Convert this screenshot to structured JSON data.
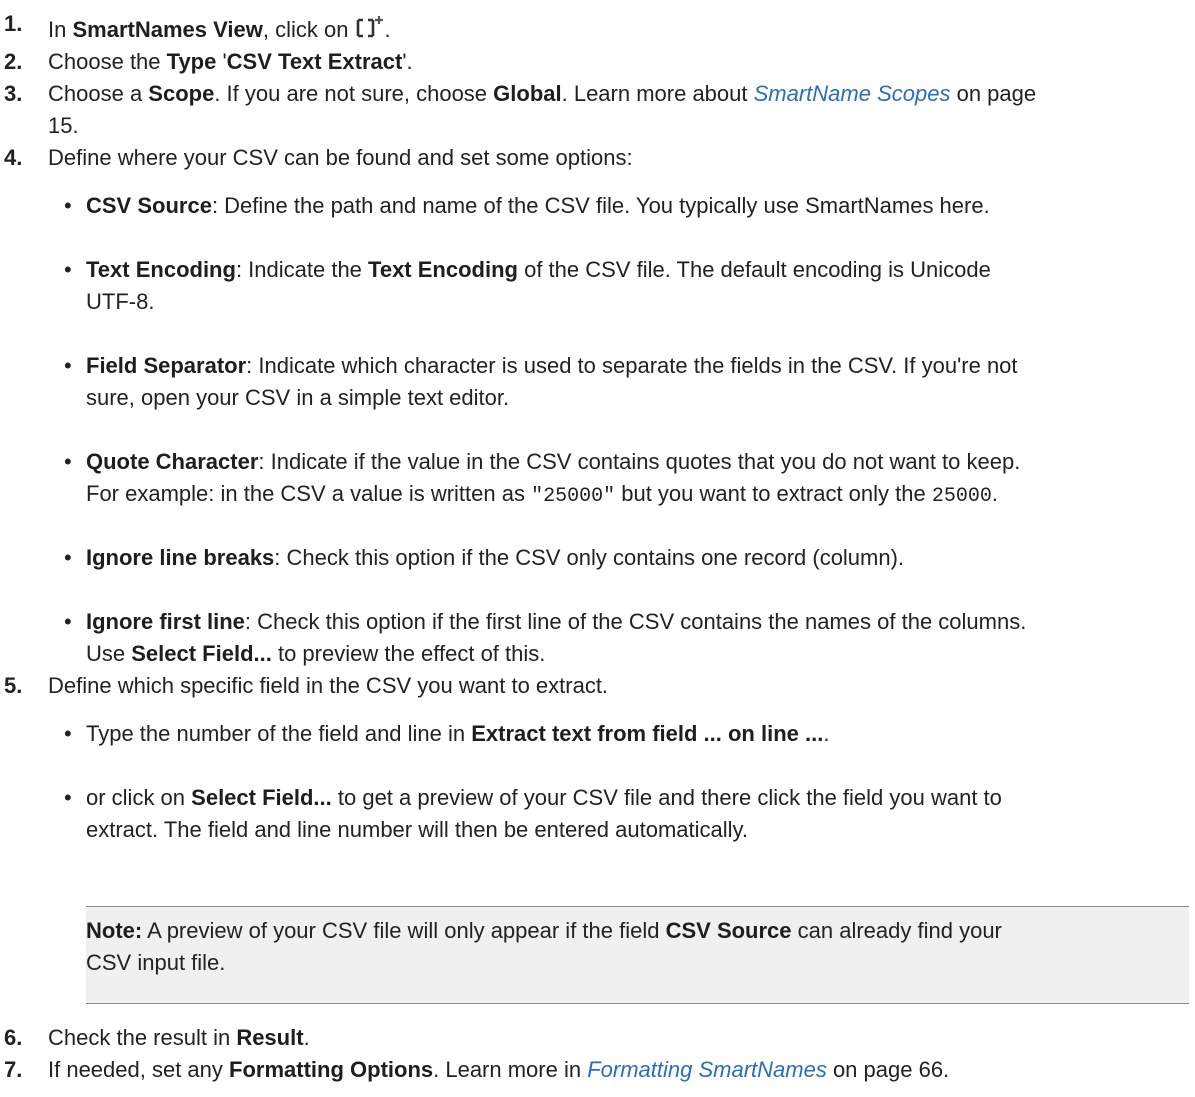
{
  "steps": [
    {
      "num": "1.",
      "a": "In ",
      "b1": "SmartNames View",
      "c": ", click on ",
      "d": "."
    },
    {
      "num": "2.",
      "a": "Choose the ",
      "b1": "Type",
      "c": " '",
      "b2": "CSV Text Extract",
      "d": "'."
    },
    {
      "num": "3.",
      "a": "Choose a ",
      "b1": "Scope",
      "c": ". If you are not sure, choose ",
      "b2": "Global",
      "d": ". Learn more about ",
      "link": "SmartName Scopes",
      "e": " on page",
      "line2": "15."
    },
    {
      "num": "4.",
      "a": "Define where your CSV can be found and set some options:"
    },
    {
      "num": "5.",
      "a": "Define which specific field in the CSV you want to extract."
    },
    {
      "num": "6.",
      "a": "Check the result in ",
      "b1": "Result",
      "c": "."
    },
    {
      "num": "7.",
      "a": "If needed, set any ",
      "b1": "Formatting Options",
      "c": ". Learn more in ",
      "link": "Formatting SmartNames",
      "d": "  on page 66."
    }
  ],
  "options": {
    "csv_source": {
      "label": "CSV Source",
      "text": ": Define the path and name of the CSV file. You typically use SmartNames here."
    },
    "text_encoding": {
      "label": "Text Encoding",
      "a": ": Indicate the ",
      "b": "Text Encoding",
      "c": " of the CSV file. The default encoding is Unicode",
      "line2": "UTF-8."
    },
    "field_separator": {
      "label": "Field Separator",
      "a": ": Indicate which character is used to separate the fields in the CSV. If you're not",
      "line2": "sure, open your CSV in a simple text editor."
    },
    "quote_character": {
      "label": "Quote Character",
      "a": ": Indicate if the value in the CSV contains quotes that you do not want to keep.",
      "line2a": "For example: in the CSV a value is written as ",
      "code1": "\"25000\"",
      "line2b": " but you want to extract only the ",
      "code2": "25000",
      "line2c": "."
    },
    "ignore_line_breaks": {
      "label": "Ignore line breaks",
      "text": ": Check this option if the CSV only contains one record (column)."
    },
    "ignore_first_line": {
      "label": "Ignore first line",
      "a": ": Check this option if the first line of the CSV contains the names of the columns.",
      "line2a": "Use ",
      "b": "Select Field...",
      "line2b": " to preview the effect of this."
    }
  },
  "extract": {
    "item1": {
      "a": "Type the number of the field and line in ",
      "b": "Extract text from field ... on line ...",
      "c": "."
    },
    "item2": {
      "a": "or click on ",
      "b": "Select Field...",
      "c": " to get a preview of your CSV file and there click the field you want to",
      "line2": "extract. The field and line number will then be entered automatically."
    }
  },
  "note": {
    "label": "Note:",
    "a": "  A preview of your CSV file will only appear if the field ",
    "b": "CSV Source",
    "c": " can already find your",
    "line2": "CSV input file."
  },
  "bullet": "•",
  "icon": "add-bracket-icon",
  "colors": {
    "link": "#2a6ebb",
    "note_bg": "#f0f0f0",
    "note_border": "#8a8a8a"
  }
}
